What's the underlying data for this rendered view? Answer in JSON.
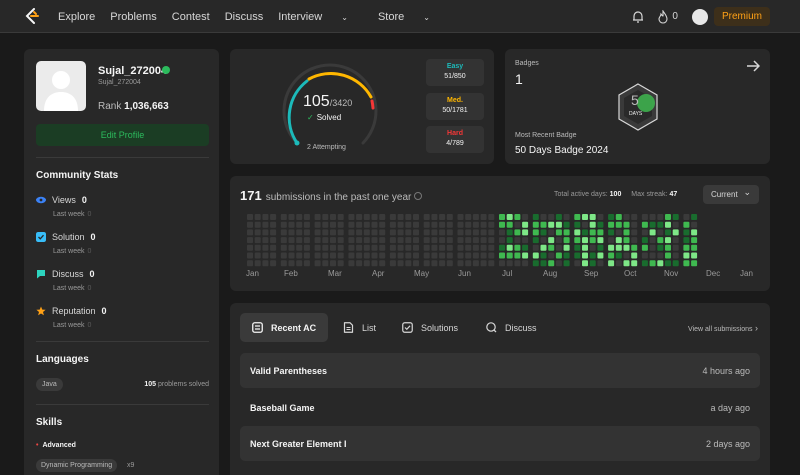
{
  "nav": {
    "links": [
      "Explore",
      "Problems",
      "Contest",
      "Discuss"
    ],
    "interview": "Interview",
    "store": "Store",
    "streak": "0",
    "premium": "Premium"
  },
  "profile": {
    "username": "Sujal_272004",
    "handle": "Sujal_272004",
    "rank_label": "Rank",
    "rank_value": "1,036,663",
    "edit_button": "Edit Profile"
  },
  "community": {
    "title": "Community Stats",
    "sub_label": "Last week",
    "items": [
      {
        "label": "Views",
        "value": "0",
        "last_week": "0",
        "icon": "eye-icon",
        "color": "#3b82f6"
      },
      {
        "label": "Solution",
        "value": "0",
        "last_week": "0",
        "icon": "solution-icon",
        "color": "#38bdf8"
      },
      {
        "label": "Discuss",
        "value": "0",
        "last_week": "0",
        "icon": "discuss-icon",
        "color": "#2dd4bf"
      },
      {
        "label": "Reputation",
        "value": "0",
        "last_week": "0",
        "icon": "star-icon",
        "color": "#ffa116"
      }
    ]
  },
  "languages": {
    "title": "Languages",
    "name": "Java",
    "count": "105",
    "suffix": "problems solved"
  },
  "skills": {
    "title": "Skills",
    "level": "Advanced",
    "tag": "Dynamic Programming",
    "count": "x9"
  },
  "solved": {
    "solved": "105",
    "total": "/3420",
    "label": "Solved",
    "attempting": "2 Attempting",
    "difficulties": [
      {
        "label": "Easy",
        "value": "51/850",
        "color": "#1cbaba"
      },
      {
        "label": "Med.",
        "value": "50/1781",
        "color": "#ffb700"
      },
      {
        "label": "Hard",
        "value": "4/789",
        "color": "#f63737"
      }
    ]
  },
  "badges": {
    "title": "Badges",
    "count": "1",
    "recent_label": "Most Recent Badge",
    "recent_name": "50 Days Badge 2024",
    "badge_text": "DAYS"
  },
  "submissions": {
    "count": "171",
    "label": "submissions in the past one year",
    "active_label": "Total active days:",
    "active_value": "100",
    "streak_label": "Max streak:",
    "streak_value": "47",
    "filter": "Current",
    "months": [
      "Jan",
      "Feb",
      "Mar",
      "Apr",
      "May",
      "Jun",
      "Jul",
      "Aug",
      "Sep",
      "Oct",
      "Nov",
      "Dec",
      "Jan"
    ]
  },
  "recent": {
    "tabs": [
      "Recent AC",
      "List",
      "Solutions",
      "Discuss"
    ],
    "view_all": "View all submissions",
    "items": [
      {
        "title": "Valid Parentheses",
        "time": "4 hours ago"
      },
      {
        "title": "Baseball Game",
        "time": "a day ago"
      },
      {
        "title": "Next Greater Element I",
        "time": "2 days ago"
      }
    ]
  }
}
